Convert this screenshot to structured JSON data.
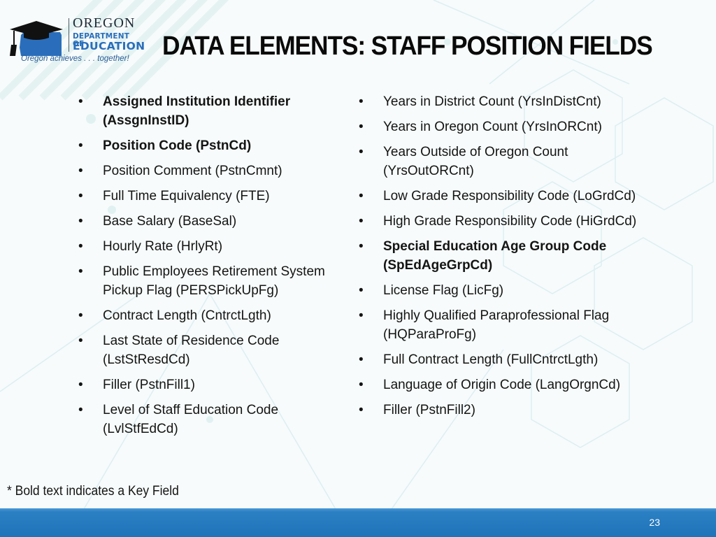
{
  "header": {
    "logo": {
      "org_line1": "OREGON",
      "org_line2": "DEPARTMENT OF",
      "org_line3": "EDUCATION",
      "tagline": "Oregon achieves . . . together!",
      "icon": "graduation-cap-oregon-map-icon",
      "brand_color": "#2a6ebb"
    },
    "title": "DATA ELEMENTS: STAFF POSITION FIELDS"
  },
  "fields": {
    "left": [
      {
        "label": "Assigned Institution Identifier (AssgnInstID)",
        "key": true
      },
      {
        "label": "Position Code (PstnCd)",
        "key": true
      },
      {
        "label": "Position Comment (PstnCmnt)",
        "key": false
      },
      {
        "label": "Full Time Equivalency (FTE)",
        "key": false
      },
      {
        "label": "Base Salary (BaseSal)",
        "key": false
      },
      {
        "label": "Hourly Rate (HrlyRt)",
        "key": false
      },
      {
        "label": "Public Employees Retirement System Pickup Flag (PERSPickUpFg)",
        "key": false
      },
      {
        "label": "Contract Length (CntrctLgth)",
        "key": false
      },
      {
        "label": "Last State of Residence Code (LstStResdCd)",
        "key": false
      },
      {
        "label": "Filler (PstnFill1)",
        "key": false
      },
      {
        "label": "Level of Staff Education Code (LvlStfEdCd)",
        "key": false
      }
    ],
    "right": [
      {
        "label": "Years in District Count (YrsInDistCnt)",
        "key": false
      },
      {
        "label": "Years in Oregon Count (YrsInORCnt)",
        "key": false
      },
      {
        "label": "Years Outside of Oregon Count (YrsOutORCnt)",
        "key": false
      },
      {
        "label": "Low Grade Responsibility Code (LoGrdCd)",
        "key": false
      },
      {
        "label": "High Grade Responsibility Code (HiGrdCd)",
        "key": false
      },
      {
        "label": "Special Education Age Group Code (SpEdAgeGrpCd)",
        "key": true
      },
      {
        "label": "License Flag (LicFg)",
        "key": false
      },
      {
        "label": "Highly Qualified Paraprofessional Flag (HQParaProFg)",
        "key": false
      },
      {
        "label": "Full Contract Length (FullCntrctLgth)",
        "key": false
      },
      {
        "label": "Language of Origin Code (LangOrgnCd)",
        "key": false
      },
      {
        "label": "Filler (PstnFill2)",
        "key": false
      }
    ],
    "bullet": "•"
  },
  "footnote": "* Bold text indicates a Key Field",
  "footer": {
    "page_number": "23",
    "bar_color": "#1f74b9"
  }
}
